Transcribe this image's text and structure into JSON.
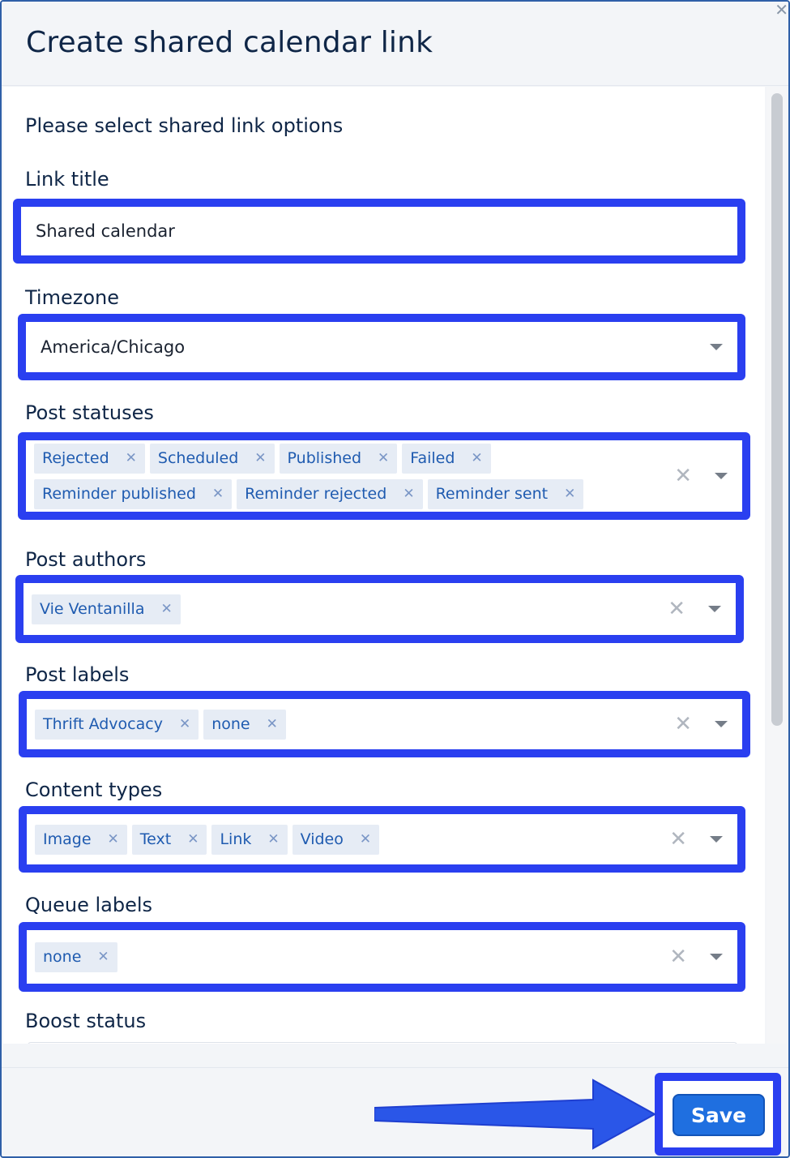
{
  "modal": {
    "title": "Create shared calendar link",
    "close_glyph": "✕"
  },
  "form": {
    "intro": "Please select shared link options",
    "link_title": {
      "label": "Link title",
      "value": "Shared calendar"
    },
    "timezone": {
      "label": "Timezone",
      "value": "America/Chicago"
    },
    "post_statuses": {
      "label": "Post statuses",
      "chips": [
        "Rejected",
        "Scheduled",
        "Published",
        "Failed",
        "Reminder published",
        "Reminder rejected",
        "Reminder sent"
      ]
    },
    "post_authors": {
      "label": "Post authors",
      "chips": [
        "Vie Ventanilla"
      ]
    },
    "post_labels": {
      "label": "Post labels",
      "chips": [
        "Thrift Advocacy",
        "none"
      ]
    },
    "content_types": {
      "label": "Content types",
      "chips": [
        "Image",
        "Text",
        "Link",
        "Video"
      ]
    },
    "queue_labels": {
      "label": "Queue labels",
      "chips": [
        "none"
      ]
    },
    "boost_status": {
      "label": "Boost status"
    }
  },
  "footer": {
    "save_label": "Save"
  },
  "icons": {
    "chip_remove": "✕",
    "clear": "✕",
    "dropdown": "chevron-down-icon",
    "arrow": "arrow-right-icon"
  },
  "colors": {
    "highlight": "#2a3ff0",
    "chip_bg": "#e6ecf5",
    "chip_text": "#1f5bb0",
    "save_bg": "#1f6fe0",
    "text_dark": "#0f2647"
  }
}
